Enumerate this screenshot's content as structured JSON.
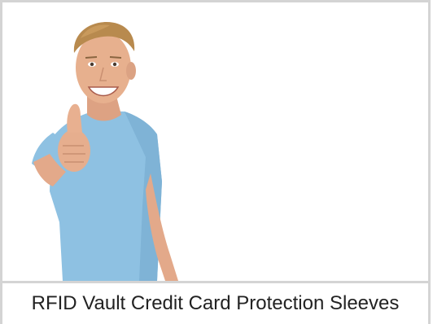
{
  "product_card": {
    "caption": "RFID Vault Credit Card Protection Sleeves",
    "image": {
      "subject": "smiling-man-thumbs-up-photo"
    }
  },
  "colors": {
    "border": "#d4d4d4",
    "text": "#222222",
    "shirt": "#8ec1e2",
    "skin": "#e7b08e",
    "hair": "#b88a4e",
    "background": "#ffffff"
  }
}
